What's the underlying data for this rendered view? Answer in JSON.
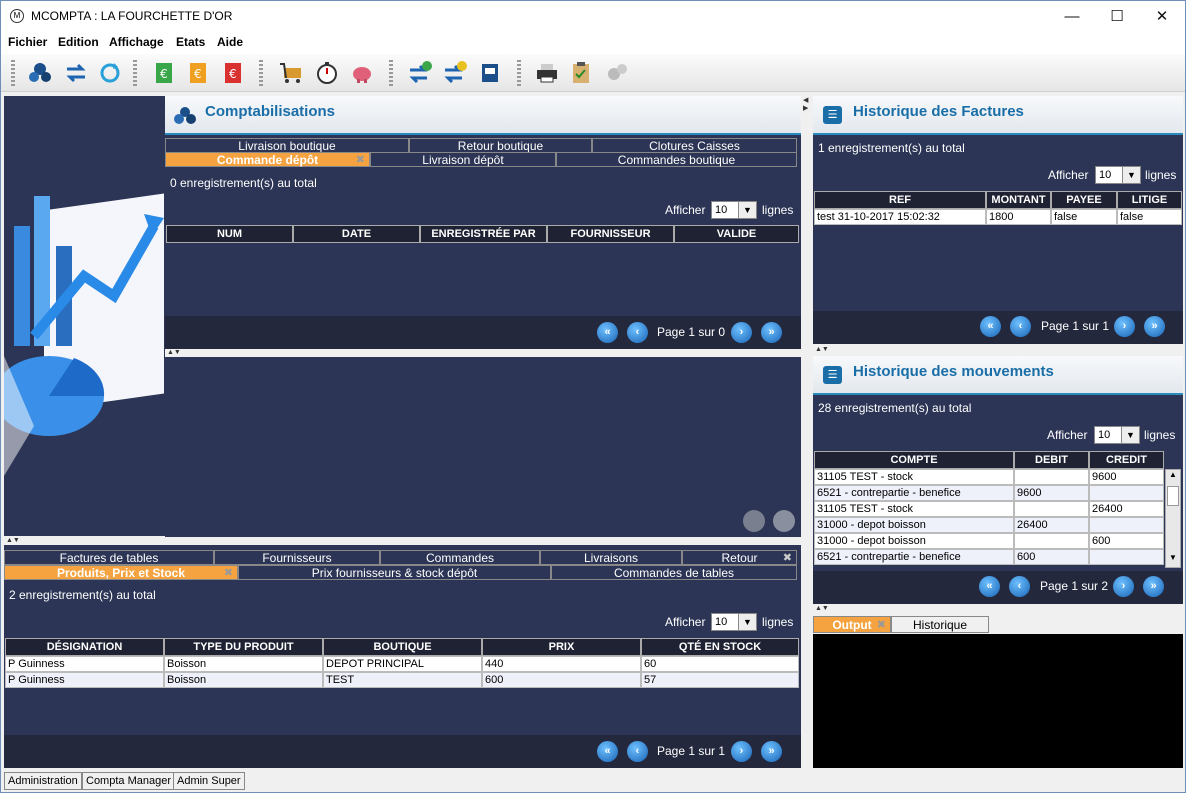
{
  "window": {
    "title": "MCOMPTA : LA FOURCHETTE D'OR",
    "minimize": "—",
    "maximize": "☐",
    "close": "✕"
  },
  "menu": [
    "Fichier",
    "Edition",
    "Affichage",
    "Etats",
    "Aide"
  ],
  "comptabilisations": {
    "title": "Comptabilisations",
    "tabs_row1": [
      "Livraison boutique",
      "Retour boutique",
      "Clotures Caisses"
    ],
    "tabs_row2": [
      "Commande dépôt",
      "Livraison dépôt",
      "Commandes boutique"
    ],
    "count": "0 enregistrement(s) au total",
    "afficher": "Afficher",
    "page_size": "10",
    "lignes": "lignes",
    "columns": [
      "NUM",
      "DATE",
      "ENREGISTRÉE PAR",
      "FOURNISSEUR",
      "VALIDE"
    ],
    "page": "Page 1 sur 0"
  },
  "bottom": {
    "tabs_row1": [
      "Factures de tables",
      "Fournisseurs",
      "Commandes",
      "Livraisons",
      "Retour"
    ],
    "tabs_row2": [
      "Produits, Prix et Stock",
      "Prix fournisseurs & stock dépôt",
      "Commandes de tables"
    ],
    "count": "2 enregistrement(s) au total",
    "afficher": "Afficher",
    "page_size": "10",
    "lignes": "lignes",
    "columns": [
      "DÉSIGNATION",
      "TYPE DU PRODUIT",
      "BOUTIQUE",
      "PRIX",
      "QTÉ EN STOCK"
    ],
    "rows": [
      [
        "P Guinness",
        "Boisson",
        "DEPOT PRINCIPAL",
        "440",
        "60"
      ],
      [
        "P Guinness",
        "Boisson",
        "TEST",
        "600",
        "57"
      ]
    ],
    "page": "Page 1 sur 1"
  },
  "factures": {
    "title": "Historique des Factures",
    "count": "1 enregistrement(s) au total",
    "afficher": "Afficher",
    "page_size": "10",
    "lignes": "lignes",
    "columns": [
      "REF",
      "MONTANT",
      "PAYEE",
      "LITIGE"
    ],
    "rows": [
      [
        "test 31-10-2017 15:02:32",
        "1800",
        "false",
        "false"
      ]
    ],
    "page": "Page 1 sur 1"
  },
  "mouvements": {
    "title": "Historique des mouvements",
    "count": "28 enregistrement(s) au total",
    "afficher": "Afficher",
    "page_size": "10",
    "lignes": "lignes",
    "columns": [
      "COMPTE",
      "DEBIT",
      "CREDIT"
    ],
    "rows": [
      [
        "31105 TEST - stock",
        "",
        "9600"
      ],
      [
        "6521 - contrepartie - benefice",
        "9600",
        ""
      ],
      [
        "31105 TEST - stock",
        "",
        "26400"
      ],
      [
        "31000 - depot boisson",
        "26400",
        ""
      ],
      [
        "31000 - depot boisson",
        "",
        "600"
      ],
      [
        "6521 - contrepartie - benefice",
        "600",
        ""
      ]
    ],
    "page": "Page 1 sur 2"
  },
  "output_tabs": [
    "Output",
    "Historique"
  ],
  "status_tabs": [
    "Administration",
    "Compta Manager",
    "Admin Super"
  ],
  "colors": {
    "panel": "#2c3555",
    "accent_tab": "#f5a340",
    "title": "#1a6ea8"
  }
}
